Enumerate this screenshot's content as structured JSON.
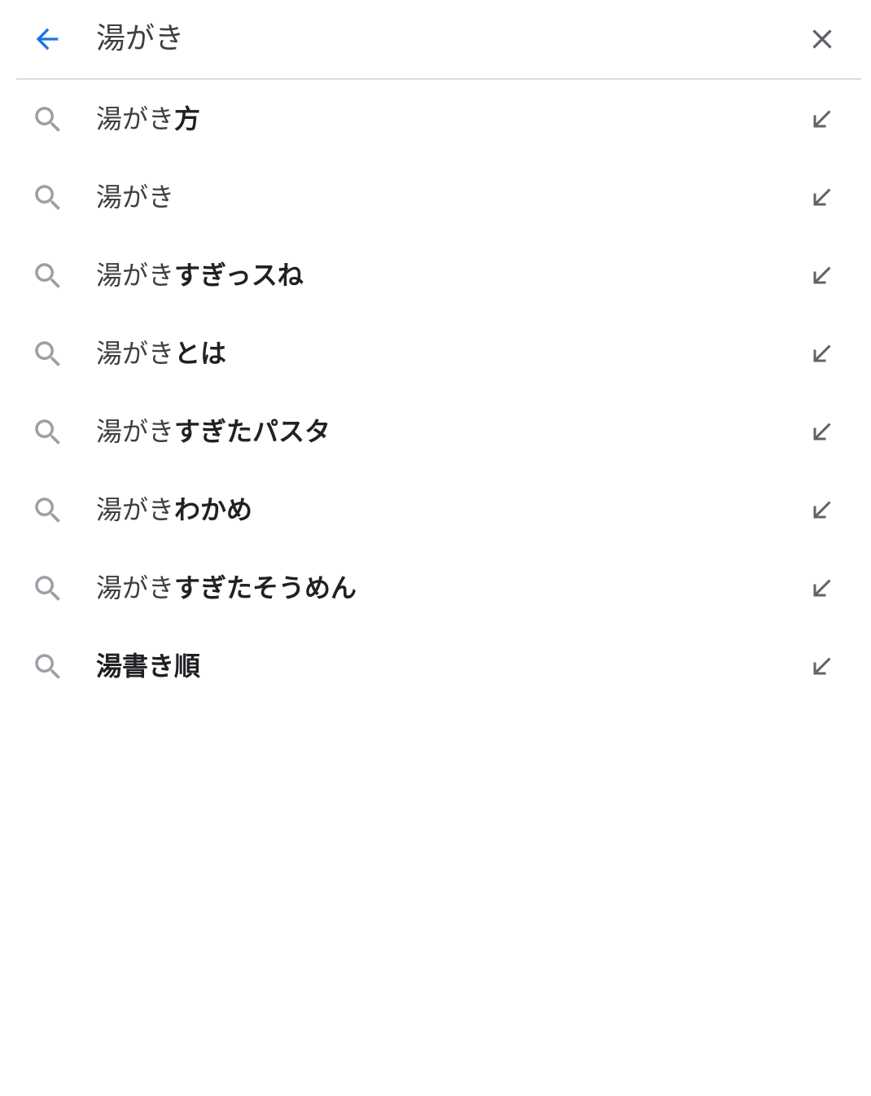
{
  "search": {
    "query": "湯がき",
    "back_icon": "arrow-back-icon",
    "clear_icon": "close-icon",
    "accent_color": "#1a73e8",
    "icon_color": "#5f6368"
  },
  "suggestions": [
    {
      "prefix": "湯がき",
      "bold": "方"
    },
    {
      "prefix": "湯がき",
      "bold": ""
    },
    {
      "prefix": "湯がき",
      "bold": "すぎっスね"
    },
    {
      "prefix": "湯がき",
      "bold": "とは"
    },
    {
      "prefix": "湯がき",
      "bold": "すぎたパスタ"
    },
    {
      "prefix": "湯がき",
      "bold": "わかめ"
    },
    {
      "prefix": "湯がき",
      "bold": "すぎたそうめん"
    },
    {
      "prefix": "",
      "bold": "湯書き順"
    }
  ],
  "row_icons": {
    "leading": "search-icon",
    "trailing": "arrow-up-left-icon"
  }
}
